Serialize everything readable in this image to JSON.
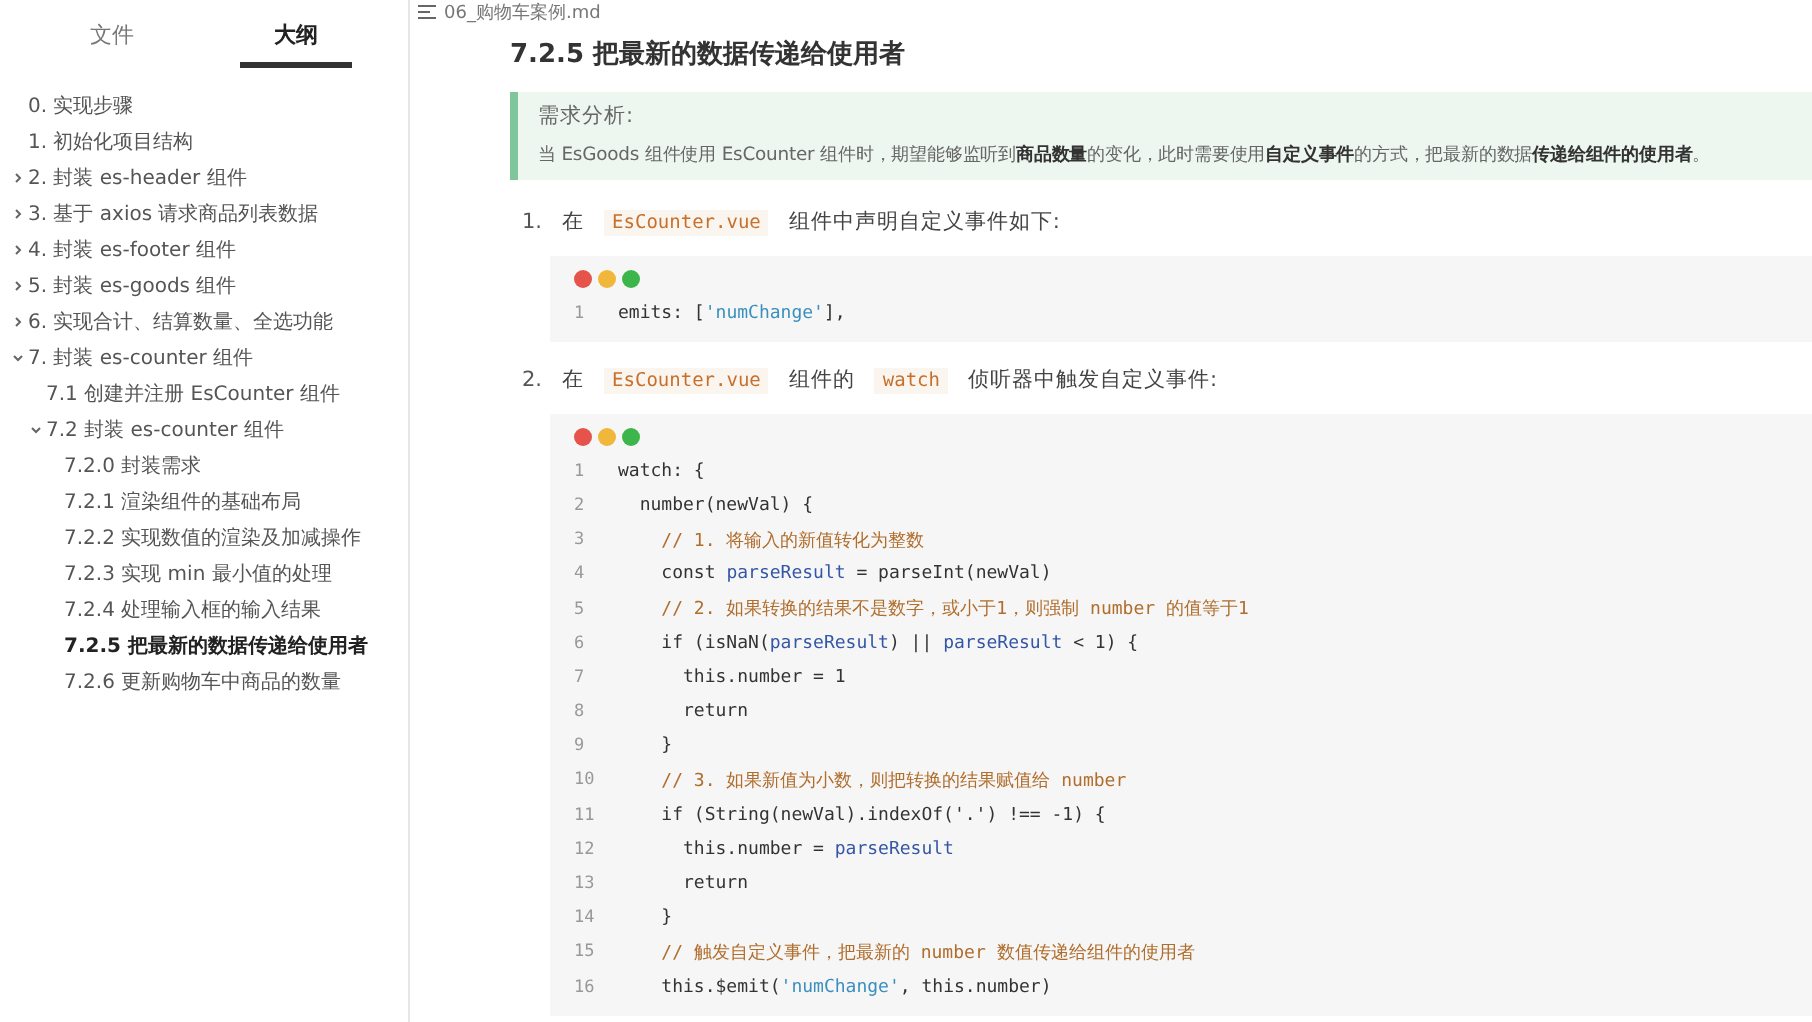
{
  "sidebar": {
    "tabs": [
      {
        "label": "文件",
        "selected": false
      },
      {
        "label": "大纲",
        "selected": true
      }
    ],
    "outline": [
      {
        "label": "0. 实现步骤",
        "selected": false
      },
      {
        "label": "1. 初始化项目结构",
        "selected": false
      },
      {
        "label": "2. 封装 es-header 组件",
        "selected": false,
        "expanded": false
      },
      {
        "label": "3. 基于 axios 请求商品列表数据",
        "selected": false,
        "expanded": false
      },
      {
        "label": "4. 封装 es-footer 组件",
        "selected": false,
        "expanded": false
      },
      {
        "label": "5. 封装 es-goods 组件",
        "selected": false,
        "expanded": false
      },
      {
        "label": "6. 实现合计、结算数量、全选功能",
        "selected": false,
        "expanded": false
      },
      {
        "label": "7. 封装 es-counter 组件",
        "selected": false,
        "expanded": true,
        "children": [
          {
            "label": "7.1 创建并注册 EsCounter 组件",
            "selected": false
          },
          {
            "label": "7.2 封装 es-counter 组件",
            "selected": false,
            "expanded": true,
            "children": [
              {
                "label": "7.2.0 封装需求",
                "selected": false
              },
              {
                "label": "7.2.1 渲染组件的基础布局",
                "selected": false
              },
              {
                "label": "7.2.2 实现数值的渲染及加减操作",
                "selected": false
              },
              {
                "label": "7.2.3 实现 min 最小值的处理",
                "selected": false
              },
              {
                "label": "7.2.4 处理输入框的输入结果",
                "selected": false
              },
              {
                "label": "7.2.5 把最新的数据传递给使用者",
                "selected": true
              },
              {
                "label": "7.2.6 更新购物车中商品的数量",
                "selected": false
              }
            ]
          }
        ]
      }
    ]
  },
  "file_name": "06_购物车案例.md",
  "heading": "7.2.5 把最新的数据传递给使用者",
  "callout": {
    "title": "需求分析:",
    "text": "当 EsGoods 组件使用 EsCounter 组件时，期望能够监听到**商品数量**的变化，此时需要使用**自定义事件**的方式，把最新的数据**传递给组件的使用者**。"
  },
  "steps": [
    {
      "number": "1.",
      "parts": [
        {
          "kind": "text",
          "text": "在"
        },
        {
          "kind": "code",
          "text": "EsCounter.vue"
        },
        {
          "kind": "text",
          "text": "组件中声明自定义事件如下:"
        }
      ],
      "code": [
        {
          "number": "1",
          "segments": [
            {
              "kind": "plain",
              "text": "emits: ["
            },
            {
              "kind": "string",
              "text": "'numChange'"
            },
            {
              "kind": "plain",
              "text": "],"
            }
          ]
        }
      ]
    },
    {
      "number": "2.",
      "parts": [
        {
          "kind": "text",
          "text": "在"
        },
        {
          "kind": "code",
          "text": "EsCounter.vue"
        },
        {
          "kind": "text",
          "text": "组件的"
        },
        {
          "kind": "code",
          "text": "watch"
        },
        {
          "kind": "text",
          "text": "侦听器中触发自定义事件:"
        }
      ],
      "code": [
        {
          "number": "1",
          "segments": [
            {
              "kind": "plain",
              "text": "watch: {"
            }
          ]
        },
        {
          "number": "2",
          "segments": [
            {
              "kind": "plain",
              "text": "  number(newVal) {"
            }
          ]
        },
        {
          "number": "3",
          "segments": [
            {
              "kind": "comment",
              "text": "    // 1. 将输入的新值转化为整数"
            }
          ]
        },
        {
          "number": "4",
          "segments": [
            {
              "kind": "plain",
              "text": "    const "
            },
            {
              "kind": "variable",
              "text": "parseResult"
            },
            {
              "kind": "plain",
              "text": " = parseInt(newVal)"
            }
          ]
        },
        {
          "number": "5",
          "segments": [
            {
              "kind": "comment",
              "text": "    // 2. 如果转换的结果不是数字，或小于1，则强制 number 的值等于1"
            }
          ]
        },
        {
          "number": "6",
          "segments": [
            {
              "kind": "plain",
              "text": "    if (isNaN("
            },
            {
              "kind": "variable",
              "text": "parseResult"
            },
            {
              "kind": "plain",
              "text": ") || "
            },
            {
              "kind": "variable",
              "text": "parseResult"
            },
            {
              "kind": "plain",
              "text": " < 1) {"
            }
          ]
        },
        {
          "number": "7",
          "segments": [
            {
              "kind": "plain",
              "text": "      this.number = 1"
            }
          ]
        },
        {
          "number": "8",
          "segments": [
            {
              "kind": "plain",
              "text": "      return"
            }
          ]
        },
        {
          "number": "9",
          "segments": [
            {
              "kind": "plain",
              "text": "    }"
            }
          ]
        },
        {
          "number": "10",
          "segments": [
            {
              "kind": "comment",
              "text": "    // 3. 如果新值为小数，则把转换的结果赋值给 number"
            }
          ]
        },
        {
          "number": "11",
          "segments": [
            {
              "kind": "plain",
              "text": "    if (String(newVal).indexOf('.') !== -1) {"
            }
          ]
        },
        {
          "number": "12",
          "segments": [
            {
              "kind": "plain",
              "text": "      this.number = "
            },
            {
              "kind": "variable",
              "text": "parseResult"
            }
          ]
        },
        {
          "number": "13",
          "segments": [
            {
              "kind": "plain",
              "text": "      return"
            }
          ]
        },
        {
          "number": "14",
          "segments": [
            {
              "kind": "plain",
              "text": "    }"
            }
          ]
        },
        {
          "number": "15",
          "segments": [
            {
              "kind": "comment",
              "text": "    // 触发自定义事件，把最新的 number 数值传递给组件的使用者"
            }
          ]
        },
        {
          "number": "16",
          "segments": [
            {
              "kind": "plain",
              "text": "    this.$emit("
            },
            {
              "kind": "string",
              "text": "'numChange'"
            },
            {
              "kind": "plain",
              "text": ", this.number)"
            }
          ]
        }
      ]
    }
  ]
}
